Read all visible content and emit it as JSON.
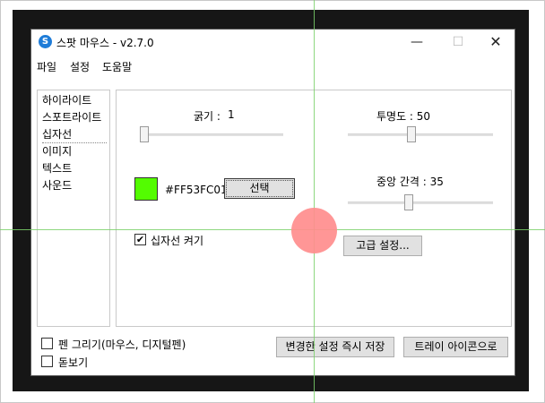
{
  "window": {
    "title": "스팟 마우스 - v2.7.0",
    "icon": "spot-mouse-app-icon",
    "icon_glyph": "S",
    "controls": {
      "minimize": "—",
      "maximize": "☐",
      "close": "✕"
    }
  },
  "menu": {
    "items": [
      "파일",
      "설정",
      "도움말"
    ]
  },
  "sidebar": {
    "items": [
      "하이라이트",
      "스포트라이트",
      "십자선",
      "이미지",
      "텍스트",
      "사운드"
    ],
    "selected_index": 2
  },
  "panel": {
    "thickness_label": "굵기 :",
    "thickness_value": "1",
    "opacity_label": "투명도 : 50",
    "gap_label": "중앙 간격 : 35",
    "color_hex": "#FF53FC01",
    "swatch_color": "#53fc01",
    "select_button": "선택",
    "enable_crosshair_label": "십자선 켜기",
    "enable_crosshair_checked": true,
    "advanced_button": "고급 설정..."
  },
  "footer": {
    "pen_label": "펜 그리기(마우스, 디지털펜)",
    "magnifier_label": "돋보기",
    "apply_button": "변경한 설정 즉시 저장",
    "tray_button": "트레이 아이콘으로"
  },
  "overlay": {
    "crosshair_color": "#7ad06a",
    "spot_color": "#ff8d8d"
  }
}
